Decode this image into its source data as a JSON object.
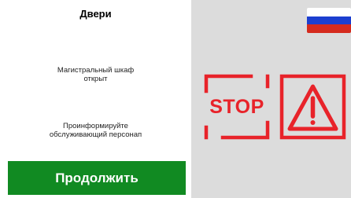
{
  "header": {
    "title": "Двери"
  },
  "messages": {
    "cabinet_open": [
      "Магистральный шкаф",
      "открыт"
    ],
    "inform_staff": [
      "Проинформируйте",
      "обслуживающий персонап"
    ]
  },
  "actions": {
    "continue_label": "Продолжить"
  },
  "signs": {
    "stop_label": "STOP",
    "warning_icon": "exclamation-triangle-icon",
    "stop_icon": "stop-sign-icon"
  },
  "language": {
    "flag": "russian-flag-icon"
  },
  "colors": {
    "accent_green": "#118a22",
    "alert_red": "#e8232a",
    "panel_gray": "#dcdcdc",
    "flag_white": "#ffffff",
    "flag_blue": "#1c3fd0",
    "flag_red": "#d52b1e"
  }
}
